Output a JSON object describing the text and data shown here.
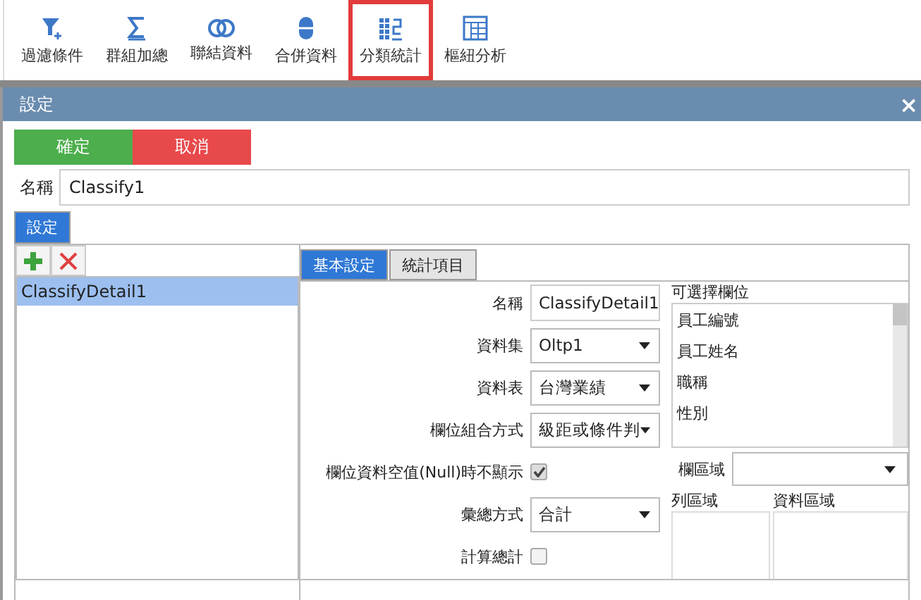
{
  "toolbar": [
    {
      "label": "過濾條件",
      "kind": "filter",
      "selected": false
    },
    {
      "label": "群組加總",
      "kind": "sum",
      "selected": false
    },
    {
      "label": "聯結資料",
      "kind": "join",
      "selected": false
    },
    {
      "label": "合併資料",
      "kind": "merge",
      "selected": false
    },
    {
      "label": "分類統計",
      "kind": "classify",
      "selected": true
    },
    {
      "label": "樞紐分析",
      "kind": "pivot",
      "selected": false
    }
  ],
  "dialog": {
    "title": "設定",
    "close": "×",
    "buttons": [
      {
        "label": "確定",
        "kind": "ok"
      },
      {
        "label": "取消",
        "kind": "cancel"
      }
    ],
    "name_label": "名稱",
    "name_value": "Classify1",
    "tabs": [
      {
        "label": "設定",
        "selected": true
      }
    ],
    "list_items": [
      {
        "label": "ClassifyDetail1",
        "selected": true
      }
    ],
    "detail_tabs": [
      {
        "label": "基本設定",
        "selected": true
      },
      {
        "label": "統計項目",
        "selected": false
      }
    ],
    "form": [
      {
        "kind": "text",
        "label": "名稱",
        "value": "ClassifyDetail1"
      },
      {
        "kind": "select",
        "label": "資料集",
        "value": "Oltp1"
      },
      {
        "kind": "select",
        "label": "資料表",
        "value": "台灣業績"
      },
      {
        "kind": "select",
        "label": "欄位組合方式",
        "value": "級距或條件判"
      },
      {
        "kind": "checkbox",
        "label": "欄位資料空值(Null)時不顯示",
        "checked": true
      },
      {
        "kind": "select",
        "label": "彙總方式",
        "value": "合計"
      },
      {
        "kind": "checkbox",
        "label": "計算總計",
        "checked": false
      }
    ],
    "fields_label": "可選擇欄位",
    "fields": [
      "員工編號",
      "員工姓名",
      "職稱",
      "性別"
    ],
    "column_area_label": "欄區域",
    "row_area_label": "列區域",
    "data_area_label": "資料區域"
  }
}
